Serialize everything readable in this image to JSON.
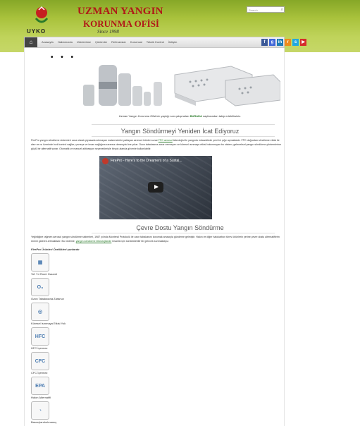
{
  "brand": {
    "title": "UZMAN YANGIN",
    "subtitle": "KORUNMA OFİSİ",
    "since": "Since 1998",
    "abbr": "UYKO"
  },
  "search": {
    "placeholder": "Search"
  },
  "nav": {
    "items": [
      "Anasayfa",
      "Hakkımızda",
      "Ürünlerimiz",
      "Çözümler",
      "Referanslar",
      "Kurumsal",
      "Teknik Kontrol",
      "İletişim"
    ]
  },
  "social": [
    {
      "icon": "facebook-icon",
      "glyph": "f",
      "color": "#3b5998"
    },
    {
      "icon": "google-plus-icon",
      "glyph": "g",
      "color": "#3f66d8"
    },
    {
      "icon": "linkedin-icon",
      "glyph": "in",
      "color": "#1f7bb6"
    },
    {
      "icon": "rss-icon",
      "glyph": "r",
      "color": "#ef8a1b"
    },
    {
      "icon": "skype-icon",
      "glyph": "s",
      "color": "#22a8e0"
    },
    {
      "icon": "youtube-icon",
      "glyph": "▶",
      "color": "#d62b2b"
    }
  ],
  "caption": {
    "before": "Uzman Yangın Korunma Ofisi'nin yaptığı son çalışmaları ",
    "link": "BURADA",
    "after": " sayfasından takip edebilirsiniz."
  },
  "section1": {
    "heading": "Yangın Söndürmeyi Yeniden İcat Ediyoruz",
    "text_before": "FirePro yangın söndürme sistemleri ucuz olarak piyasada sıkmayan malzemelerle patlayan aeresol ürünler sunar ",
    "link": "FPC aerosol",
    "text_after": " teknolojisi ile yangınla mücadelede yeni bir çığır açmaktadır. FPC doğrudan söndürme etkisi ile alev ve ısı üzerinde hızlı kontrol sağlar; çevreye ve insan sağlığına zararsız olmasıyla öne çıkar. Ozon tabakasına zarar vermeyen ve küresel ısınmaya etkisi bulunmayan bu sistem, geleneksel yangın söndürme yöntemlerine güçlü bir alternatif sunar. Otomatik ve manuel aktivasyon seçenekleriyle birçok alanda güvenle kullanılabilir."
  },
  "video": {
    "title": "FirePro - Here's to the Dreamers of a Sustai..."
  },
  "section2": {
    "heading": "Çevre Dostu Yangın Söndürme",
    "text_before": "Yeğinliğine rağmen aerosol yangın söndürme sistemleri, 1987 yılında Montreal Protokolü ile ozon tabakasını korumak amacıyla gündeme gelmiştir. Halon ve diğer halokarbon türevi ürünlerin yerine çevre dostu alternatiflerin önemi giderek artmaktadır. Bu nedenle, ",
    "link": "yangın söndürme teknolojisinde",
    "text_after": " insanlık için sürdürülebilir bir gelecek sunmaktayız."
  },
  "features": {
    "heading": "FirePro Ürünleri Özellikleri şunlardır",
    "items": [
      {
        "label": "%0 Yıl Ömrü Garanti",
        "icon": "calendar-grid-icon",
        "glyph": "▦"
      },
      {
        "label": "Ozon Tabakasına Zararsız",
        "icon": "ozone-icon",
        "glyph": "O₃"
      },
      {
        "label": "Küresel Isınmaya Etkisi Yok",
        "icon": "globe-icon",
        "glyph": "◎"
      },
      {
        "label": "HFC İçermez",
        "icon": "hfc-icon",
        "glyph": "HFC"
      },
      {
        "label": "CFC İçermez",
        "icon": "cfc-icon",
        "glyph": "CFC"
      },
      {
        "label": "Halon Alternatifi",
        "icon": "epa-snap-icon",
        "glyph": "EPA"
      },
      {
        "label": "Basınçlandırılmamış",
        "icon": "pressure-gauge-icon",
        "glyph": "◔"
      }
    ]
  }
}
